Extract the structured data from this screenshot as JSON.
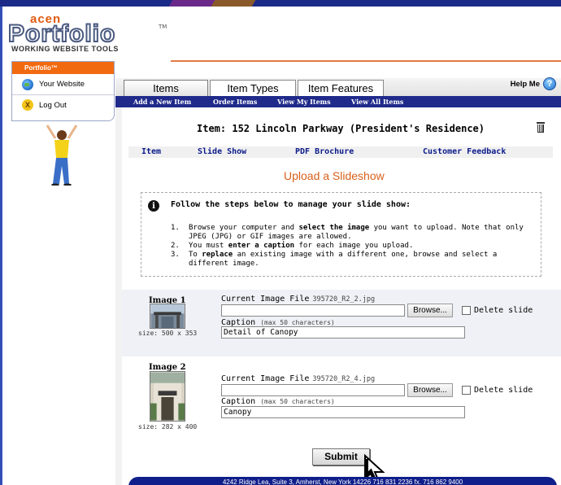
{
  "branding": {
    "acen": "acen",
    "portfolio": "Portfolio",
    "tm": "TM",
    "tools": "WORKING WEBSITE TOOLS"
  },
  "sidebar": {
    "header": "Portfolio™",
    "items": [
      {
        "label": "Your Website",
        "icon": "globe-icon"
      },
      {
        "label": "Log Out",
        "icon": "logout-icon"
      }
    ]
  },
  "tabs": [
    {
      "label": "Items",
      "active": true
    },
    {
      "label": "Item Types",
      "active": false
    },
    {
      "label": "Item Features",
      "active": false
    }
  ],
  "help": {
    "label": "Help Me",
    "icon": "?"
  },
  "subnav": [
    "Add a New Item",
    "Order Items",
    "View My Items",
    "View All Items"
  ],
  "item": {
    "title": "Item: 152 Lincoln Parkway (President's Residence)",
    "nav": [
      "Item",
      "Slide Show",
      "PDF Brochure",
      "Customer Feedback"
    ]
  },
  "page": {
    "heading": "Upload a Slideshow",
    "instructions_lead": "Follow the steps below to manage your slide show:",
    "steps": [
      {
        "n": "1.",
        "parts": [
          "Browse your computer and ",
          "select the image",
          " you want to upload. Note that only JPEG (JPG) or GIF images are allowed."
        ]
      },
      {
        "n": "2.",
        "parts": [
          "You must ",
          "enter a caption",
          " for each image you upload."
        ]
      },
      {
        "n": "3.",
        "parts": [
          "To ",
          "replace",
          " an existing image with a different one, browse and select a different image."
        ]
      }
    ]
  },
  "images": [
    {
      "label": "Image 1",
      "size": "size: 500 x 353",
      "current_label": "Current Image File",
      "current_file": "395720_R2_2.jpg",
      "browse": "Browse...",
      "delete": "Delete slide",
      "caption_label": "Caption",
      "caption_hint": "(max 50 characters)",
      "caption": "Detail of Canopy"
    },
    {
      "label": "Image 2",
      "size": "size: 282 x 400",
      "current_label": "Current Image File",
      "current_file": "395720_R2_4.jpg",
      "browse": "Browse...",
      "delete": "Delete slide",
      "caption_label": "Caption",
      "caption_hint": "(max 50 characters)",
      "caption": "Canopy"
    }
  ],
  "submit": "Submit",
  "footer": "4242 Ridge Lea, Suite 3, Amherst, New York 14226          716 831 2236   fx. 716 862 9400",
  "colors": {
    "accent": "#e05a10",
    "navy": "#1f2a8a",
    "heading": "#d8601a"
  }
}
